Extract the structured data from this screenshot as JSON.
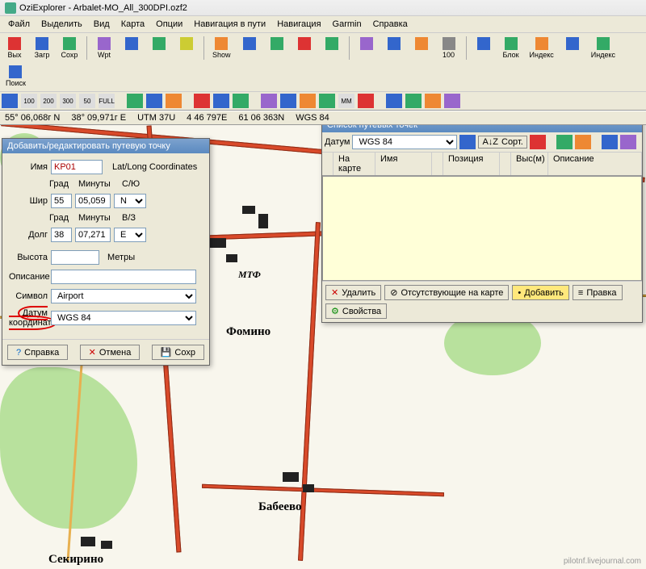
{
  "title": "OziExplorer - Arbalet-MO_All_300DPI.ozf2",
  "menu": [
    "Файл",
    "Выделить",
    "Вид",
    "Карта",
    "Опции",
    "Навигация в пути",
    "Навигация",
    "Garmin",
    "Справка"
  ],
  "toolbar1": [
    {
      "label": "Вых",
      "color": "ico-red"
    },
    {
      "label": "Загр",
      "color": "ico-blue"
    },
    {
      "label": "Сохр",
      "color": "ico-green"
    },
    {
      "label": "Wpt",
      "color": "ico-purple"
    },
    {
      "label": "",
      "color": "ico-blue"
    },
    {
      "label": "",
      "color": "ico-green"
    },
    {
      "label": "",
      "color": "ico-yellow"
    },
    {
      "label": "Show",
      "color": "ico-orange"
    },
    {
      "label": "",
      "color": "ico-blue"
    },
    {
      "label": "",
      "color": "ico-green"
    },
    {
      "label": "",
      "color": "ico-red"
    },
    {
      "label": "",
      "color": "ico-green"
    },
    {
      "label": "",
      "color": "ico-purple"
    },
    {
      "label": "",
      "color": "ico-blue"
    },
    {
      "label": "",
      "color": "ico-orange"
    },
    {
      "label": "100",
      "color": ""
    },
    {
      "label": "",
      "color": "ico-blue"
    },
    {
      "label": "Блок",
      "color": "ico-green"
    },
    {
      "label": "Индекс",
      "color": "ico-orange"
    },
    {
      "label": "",
      "color": "ico-blue"
    },
    {
      "label": "Индекс",
      "color": "ico-green"
    },
    {
      "label": "Поиск",
      "color": "ico-blue"
    }
  ],
  "status": {
    "lat": "55° 06,068г N",
    "lon": "38° 09,971г E",
    "utm": "UTM  37U",
    "e": "4 46 797E",
    "n": "61 06 363N",
    "datum": "WGS 84"
  },
  "wp_dialog": {
    "title": "Добавить/редактировать путевую точку",
    "name_lbl": "Имя",
    "name_val": "KP01",
    "coord_type": "Lat/Long Coordinates",
    "grad": "Град",
    "min": "Минуты",
    "ns": "С/Ю",
    "lat_lbl": "Шир",
    "lat_deg": "55",
    "lat_min": "05,059",
    "lat_ns": "N",
    "ew": "В/З",
    "lon_lbl": "Долг",
    "lon_deg": "38",
    "lon_min": "07,271",
    "lon_ew": "E",
    "alt_lbl": "Высота",
    "alt_unit": "Метры",
    "desc_lbl": "Описание",
    "sym_lbl": "Символ",
    "sym_val": "Airport",
    "datum_lbl": "Датум координат",
    "datum_val": "WGS 84",
    "help": "Справка",
    "cancel": "Отмена",
    "save": "Сохр"
  },
  "wpt_panel": {
    "title": "Список путевых точек",
    "datum_lbl": "Датум",
    "datum_val": "WGS 84",
    "sort": "Сорт.",
    "headers": [
      "",
      "На карте",
      "Имя",
      "",
      "Позиция",
      "",
      "Выс(м)",
      "Описание"
    ],
    "del": "Удалить",
    "missing": "Отсутствующие на карте",
    "add": "Добавить",
    "edit": "Правка",
    "props": "Свойства"
  },
  "towns": {
    "fomino": "Фомино",
    "babeevo": "Бабеево",
    "sekirino": "Секирино",
    "mtf": "МТФ"
  },
  "watermark": "pilotnf.livejournal.com"
}
